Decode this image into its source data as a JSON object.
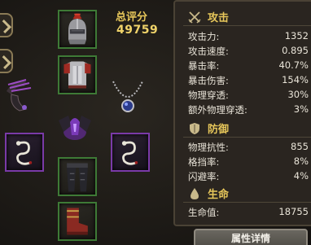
{
  "score": {
    "label": "总评分",
    "value": "49759"
  },
  "left_tabs": [
    "chevron-right-icon",
    "chevron-right-icon"
  ],
  "slots": {
    "helmet": {
      "icon": "plumed-helmet-icon",
      "rarity": "green"
    },
    "armor": {
      "icon": "chest-armor-icon",
      "rarity": "green"
    },
    "weapon": {
      "icon": "claw-blade-icon",
      "rarity": "none"
    },
    "amulet": {
      "icon": "pearl-amulet-icon",
      "rarity": "none"
    },
    "shoulder": {
      "icon": "dark-pauldron-icon",
      "rarity": "none"
    },
    "ring_left": {
      "icon": "serpent-ring-icon",
      "rarity": "purple"
    },
    "ring_right": {
      "icon": "serpent-ring-icon",
      "rarity": "purple"
    },
    "pants": {
      "icon": "leg-armor-icon",
      "rarity": "green"
    },
    "boots": {
      "icon": "red-boots-icon",
      "rarity": "green"
    }
  },
  "attack": {
    "title": "攻击",
    "icon": "crossed-swords-icon",
    "rows": [
      {
        "label": "攻击力:",
        "value": "1352"
      },
      {
        "label": "攻击速度:",
        "value": "0.895"
      },
      {
        "label": "暴击率:",
        "value": "40.7%"
      },
      {
        "label": "暴击伤害:",
        "value": "154%"
      },
      {
        "label": "物理穿透:",
        "value": "30%"
      },
      {
        "label": "额外物理穿透:",
        "value": "3%"
      }
    ]
  },
  "defense": {
    "title": "防御",
    "icon": "shield-icon",
    "rows": [
      {
        "label": "物理抗性:",
        "value": "855"
      },
      {
        "label": "格挡率:",
        "value": "8%"
      },
      {
        "label": "闪避率:",
        "value": "4%"
      }
    ]
  },
  "life": {
    "title": "生命",
    "icon": "blood-drop-icon",
    "rows": [
      {
        "label": "生命值:",
        "value": "18755"
      }
    ]
  },
  "detail_button": "属性详情",
  "colors": {
    "gold": "#e6c65a",
    "green_frame": "#3e7a36",
    "purple_frame": "#7a3aa8"
  }
}
